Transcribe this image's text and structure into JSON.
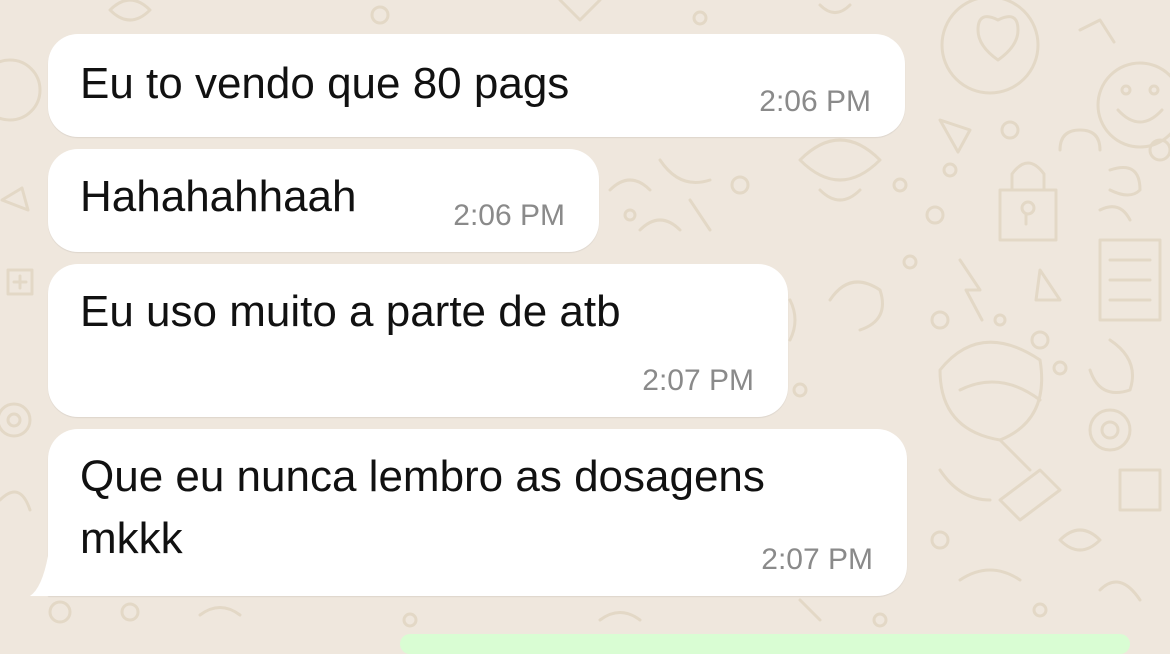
{
  "colors": {
    "wallpaper": "#efe7dd",
    "doodle": "#e3d8c6",
    "bubble_incoming": "#ffffff",
    "bubble_outgoing": "#d9fdd3",
    "text": "#111111",
    "timestamp": "#8a8a8a"
  },
  "messages": [
    {
      "text": "Eu to vendo que 80 pags",
      "time": "2:06 PM"
    },
    {
      "text": "Hahahahhaah",
      "time": "2:06 PM"
    },
    {
      "text": "Eu uso muito a parte de atb",
      "time": "2:07 PM"
    },
    {
      "text": "Que eu nunca lembro as dosagens\nmkkk",
      "time": "2:07 PM"
    }
  ]
}
